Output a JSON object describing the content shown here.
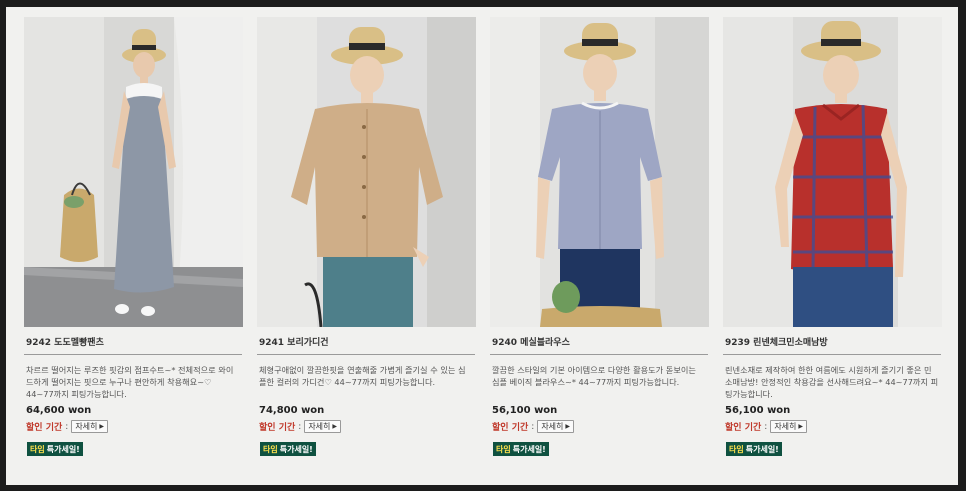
{
  "products": [
    {
      "title": "9242 도도멜빵팬츠",
      "description": "차르르 떨어지는 루즈한 핏감의 점프수트~* 전체적으로 와이드하게 떨어지는 핏으로 누구나 편안하게 착용해요~♡ 44~77까지 피팅가능합니다.",
      "price": "64,600 won",
      "sale_label": "할인 기간",
      "detail_button": "자세히",
      "badge_main": "타임",
      "badge_sub": "특가세일!"
    },
    {
      "title": "9241 보리가디건",
      "description": "체형구애없이 깔끔한핏을 연출해줄 가볍게 즐기실 수 있는 심플한 컬러의 가디건♡ 44~77까지 피팅가능합니다.",
      "price": "74,800 won",
      "sale_label": "할인 기간",
      "detail_button": "자세히",
      "badge_main": "타임",
      "badge_sub": "특가세일!"
    },
    {
      "title": "9240 메실블라우스",
      "description": "깔끔한 스타일의 기본 아이템으로 다양한 활용도가 돋보이는 심플 베이직 블라우스~* 44~77까지 피팅가능합니다.",
      "price": "56,100 won",
      "sale_label": "할인 기간",
      "detail_button": "자세히",
      "badge_main": "타임",
      "badge_sub": "특가세일!"
    },
    {
      "title": "9239 린넨체크민소매남방",
      "description": "린넨소재로 제작하여 한한 여름에도 시원하게 즐기기 좋은 민소매남방! 안정적인 착용감을 선사해드려요~* 44~77까지 피팅가능합니다.",
      "price": "56,100 won",
      "sale_label": "할인 기간",
      "detail_button": "자세히",
      "badge_main": "타임",
      "badge_sub": "특가세일!"
    }
  ],
  "colors": {
    "page_background": "#f1f1ef",
    "frame": "#1c1c1c",
    "sale_label": "#c0392b",
    "badge_background": "#0f5140",
    "badge_highlight": "#ffe24d"
  }
}
